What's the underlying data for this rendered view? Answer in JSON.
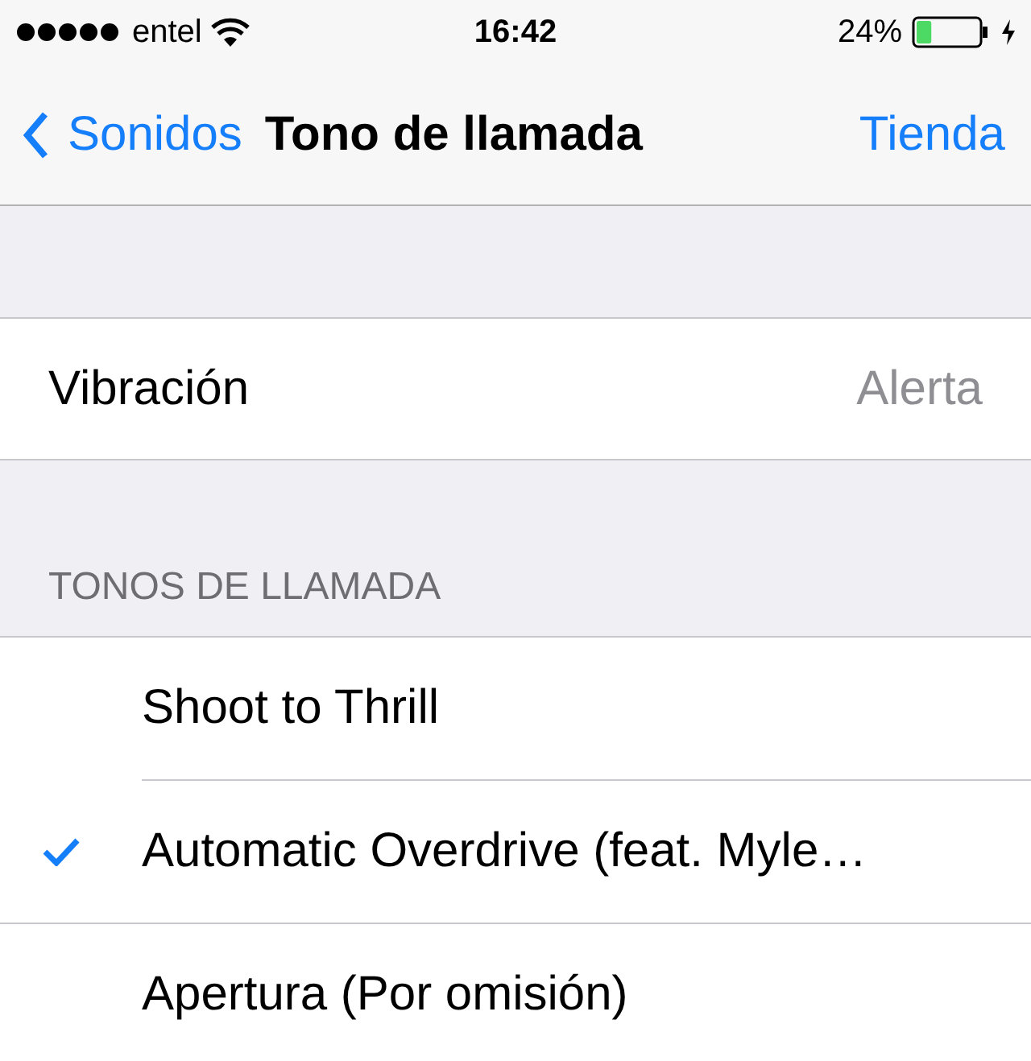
{
  "status_bar": {
    "carrier": "entel",
    "time": "16:42",
    "battery_percent": "24%",
    "battery": {
      "level": 0.24
    }
  },
  "nav": {
    "back": "Sonidos",
    "title": "Tono de llamada",
    "action": "Tienda"
  },
  "vibration": {
    "label": "Vibración",
    "value": "Alerta"
  },
  "ringtones": {
    "header": "TONOS DE LLAMADA",
    "items": [
      {
        "label": "Shoot to Thrill",
        "selected": false
      },
      {
        "label": "Automatic Overdrive (feat. Myle…",
        "selected": true
      },
      {
        "label": "Apertura (Por omisión)",
        "selected": false
      }
    ]
  }
}
